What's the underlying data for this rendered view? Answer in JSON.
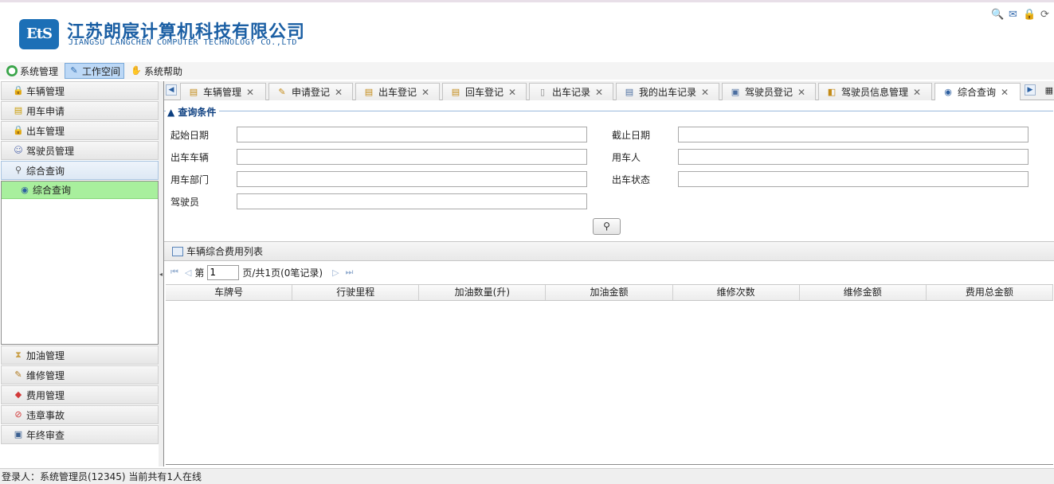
{
  "header": {
    "logo_text": "EtS",
    "company_cn": "江苏朗宸计算机科技有限公司",
    "company_en": "JIANGSU LANGCHEN COMPUTER TECHNOLOGY CO.,LTD"
  },
  "menubar": {
    "items": [
      {
        "label": "系统管理",
        "icon": "globe-icon"
      },
      {
        "label": "工作空间",
        "icon": "wrench-icon",
        "active": true
      },
      {
        "label": "系统帮助",
        "icon": "help-icon"
      }
    ]
  },
  "sidebar": {
    "top_items": [
      "车辆管理",
      "用车申请",
      "出车管理",
      "驾驶员管理"
    ],
    "open_item": "综合查询",
    "sub_item": "综合查询",
    "bottom_items": [
      "加油管理",
      "维修管理",
      "费用管理",
      "违章事故",
      "年终审查"
    ]
  },
  "tabs": [
    "车辆管理",
    "申请登记",
    "出车登记",
    "回车登记",
    "出车记录",
    "我的出车记录",
    "驾驶员登记",
    "驾驶员信息管理",
    "综合查询"
  ],
  "query": {
    "legend": "查询条件",
    "labels": {
      "start_date": "起始日期",
      "end_date": "截止日期",
      "vehicle": "出车车辆",
      "user": "用车人",
      "dept": "用车部门",
      "status": "出车状态",
      "driver": "驾驶员"
    }
  },
  "grid": {
    "title": "车辆综合费用列表",
    "pager": {
      "page_prefix": "第",
      "page_value": "1",
      "page_suffix": "页/共1页(0笔记录)"
    },
    "columns": [
      "车牌号",
      "行驶里程",
      "加油数量(升)",
      "加油金额",
      "维修次数",
      "维修金额",
      "费用总金额"
    ]
  },
  "status": {
    "text": "登录人：系统管理员(12345)  当前共有1人在线"
  },
  "colors": {
    "brand": "#1b5fa4",
    "active_subitem": "#a8ef9d",
    "active_menu": "#bcd8f6"
  }
}
